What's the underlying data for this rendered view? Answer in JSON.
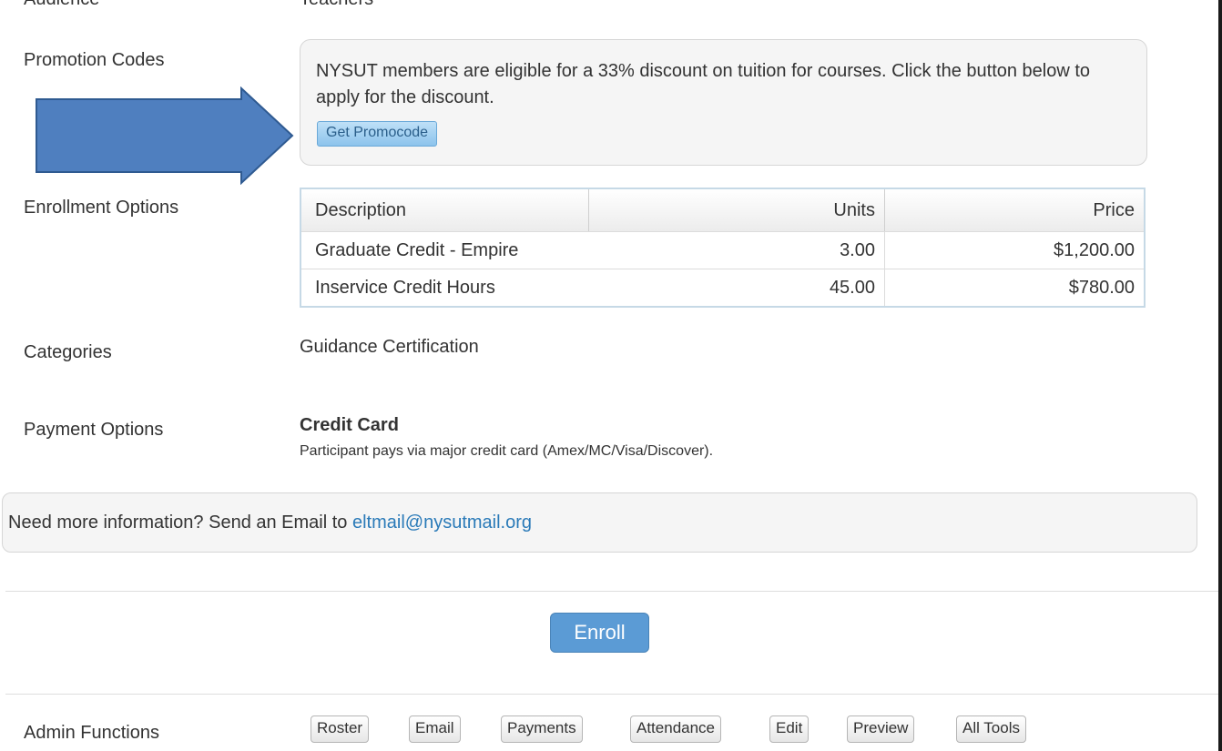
{
  "fields": {
    "audience_label": "Audience",
    "audience_value": "Teachers",
    "promotion_label": "Promotion Codes",
    "enrollment_label": "Enrollment Options",
    "categories_label": "Categories",
    "payment_label": "Payment Options",
    "admin_label": "Admin Functions"
  },
  "promo": {
    "text": "NYSUT members are eligible for a 33% discount on tuition for courses. Click the button below to apply for the discount.",
    "button": "Get Promocode",
    "arrow_color": "#4f7fbf"
  },
  "enrollment": {
    "headers": [
      "Description",
      "Units",
      "Price"
    ],
    "rows": [
      {
        "description": "Graduate Credit - Empire",
        "units": "3.00",
        "price": "$1,200.00"
      },
      {
        "description": "Inservice Credit Hours",
        "units": "45.00",
        "price": "$780.00"
      }
    ]
  },
  "categories": {
    "value": "Guidance Certification"
  },
  "payment": {
    "title": "Credit Card",
    "description": "Participant pays via major credit card (Amex/MC/Visa/Discover)."
  },
  "info": {
    "text": "Need more information? Send an Email to ",
    "email": "eltmail@nysutmail.org"
  },
  "enroll_button": "Enroll",
  "admin_buttons": [
    "Roster",
    "Email",
    "Payments",
    "Attendance",
    "Edit",
    "Preview",
    "All Tools"
  ]
}
